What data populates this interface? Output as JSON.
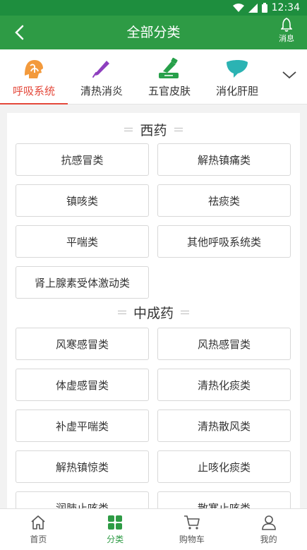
{
  "status": {
    "time": "12:34"
  },
  "header": {
    "title": "全部分类",
    "message_label": "消息"
  },
  "categories": [
    {
      "label": "呼吸系统",
      "icon": "lungs-icon",
      "active": true
    },
    {
      "label": "清热消炎",
      "icon": "thermometer-icon",
      "active": false
    },
    {
      "label": "五官皮肤",
      "icon": "skin-care-icon",
      "active": false
    },
    {
      "label": "消化肝胆",
      "icon": "liver-icon",
      "active": false
    }
  ],
  "sections": [
    {
      "title": "西药",
      "items": [
        "抗感冒类",
        "解热镇痛类",
        "镇咳类",
        "祛痰类",
        "平喘类",
        "其他呼吸系统类",
        "肾上腺素受体激动类"
      ]
    },
    {
      "title": "中成药",
      "items": [
        "风寒感冒类",
        "风热感冒类",
        "体虚感冒类",
        "清热化痰类",
        "补虚平喘类",
        "清热散风类",
        "解热镇惊类",
        "止咳化痰类",
        "润肺止咳类",
        "散寒止咳类"
      ]
    }
  ],
  "tabbar": [
    {
      "label": "首页",
      "icon": "home-icon",
      "active": false
    },
    {
      "label": "分类",
      "icon": "grid-icon",
      "active": true
    },
    {
      "label": "购物车",
      "icon": "cart-icon",
      "active": false
    },
    {
      "label": "我的",
      "icon": "user-icon",
      "active": false
    }
  ],
  "colors": {
    "primary": "#2e9b45",
    "accent": "#e4493b"
  }
}
